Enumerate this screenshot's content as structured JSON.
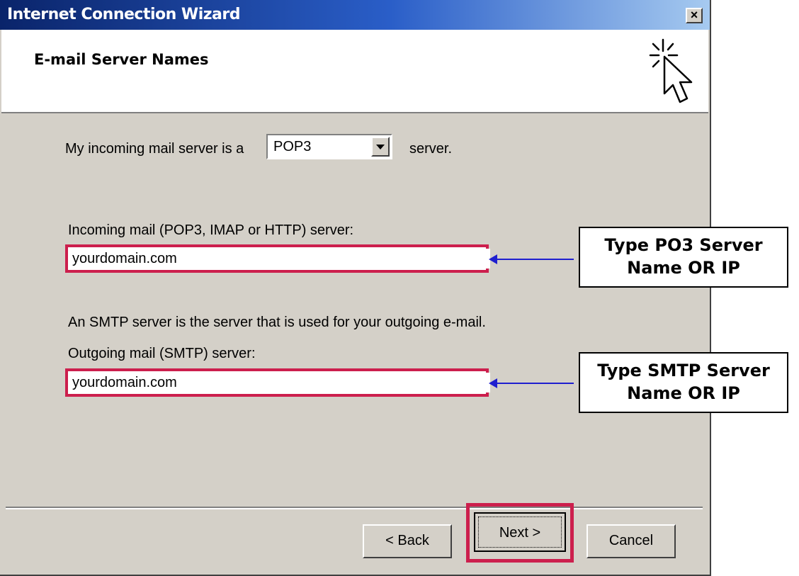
{
  "window": {
    "title": "Internet Connection Wizard",
    "close_glyph": "×"
  },
  "header": {
    "title": "E-mail Server Names",
    "icon": "wizard-cursor-icon"
  },
  "form": {
    "server_type_prefix": "My incoming mail server is a",
    "server_type_value": "POP3",
    "server_type_suffix": "server.",
    "incoming_label": "Incoming mail (POP3, IMAP or HTTP) server:",
    "incoming_value": "yourdomain.com",
    "smtp_note": "An SMTP server is the server that is used for your outgoing e-mail.",
    "outgoing_label": "Outgoing mail (SMTP) server:",
    "outgoing_value": "yourdomain.com"
  },
  "buttons": {
    "back": "< Back",
    "next": "Next >",
    "cancel": "Cancel"
  },
  "annotations": {
    "incoming_callout": [
      "Type PO3 Server",
      "Name OR IP"
    ],
    "outgoing_callout": [
      "Type SMTP Server",
      "Name OR IP"
    ]
  },
  "colors": {
    "highlight": "#cc1f4d",
    "arrow": "#1f1fcf",
    "titlebar": "#0a246a"
  }
}
